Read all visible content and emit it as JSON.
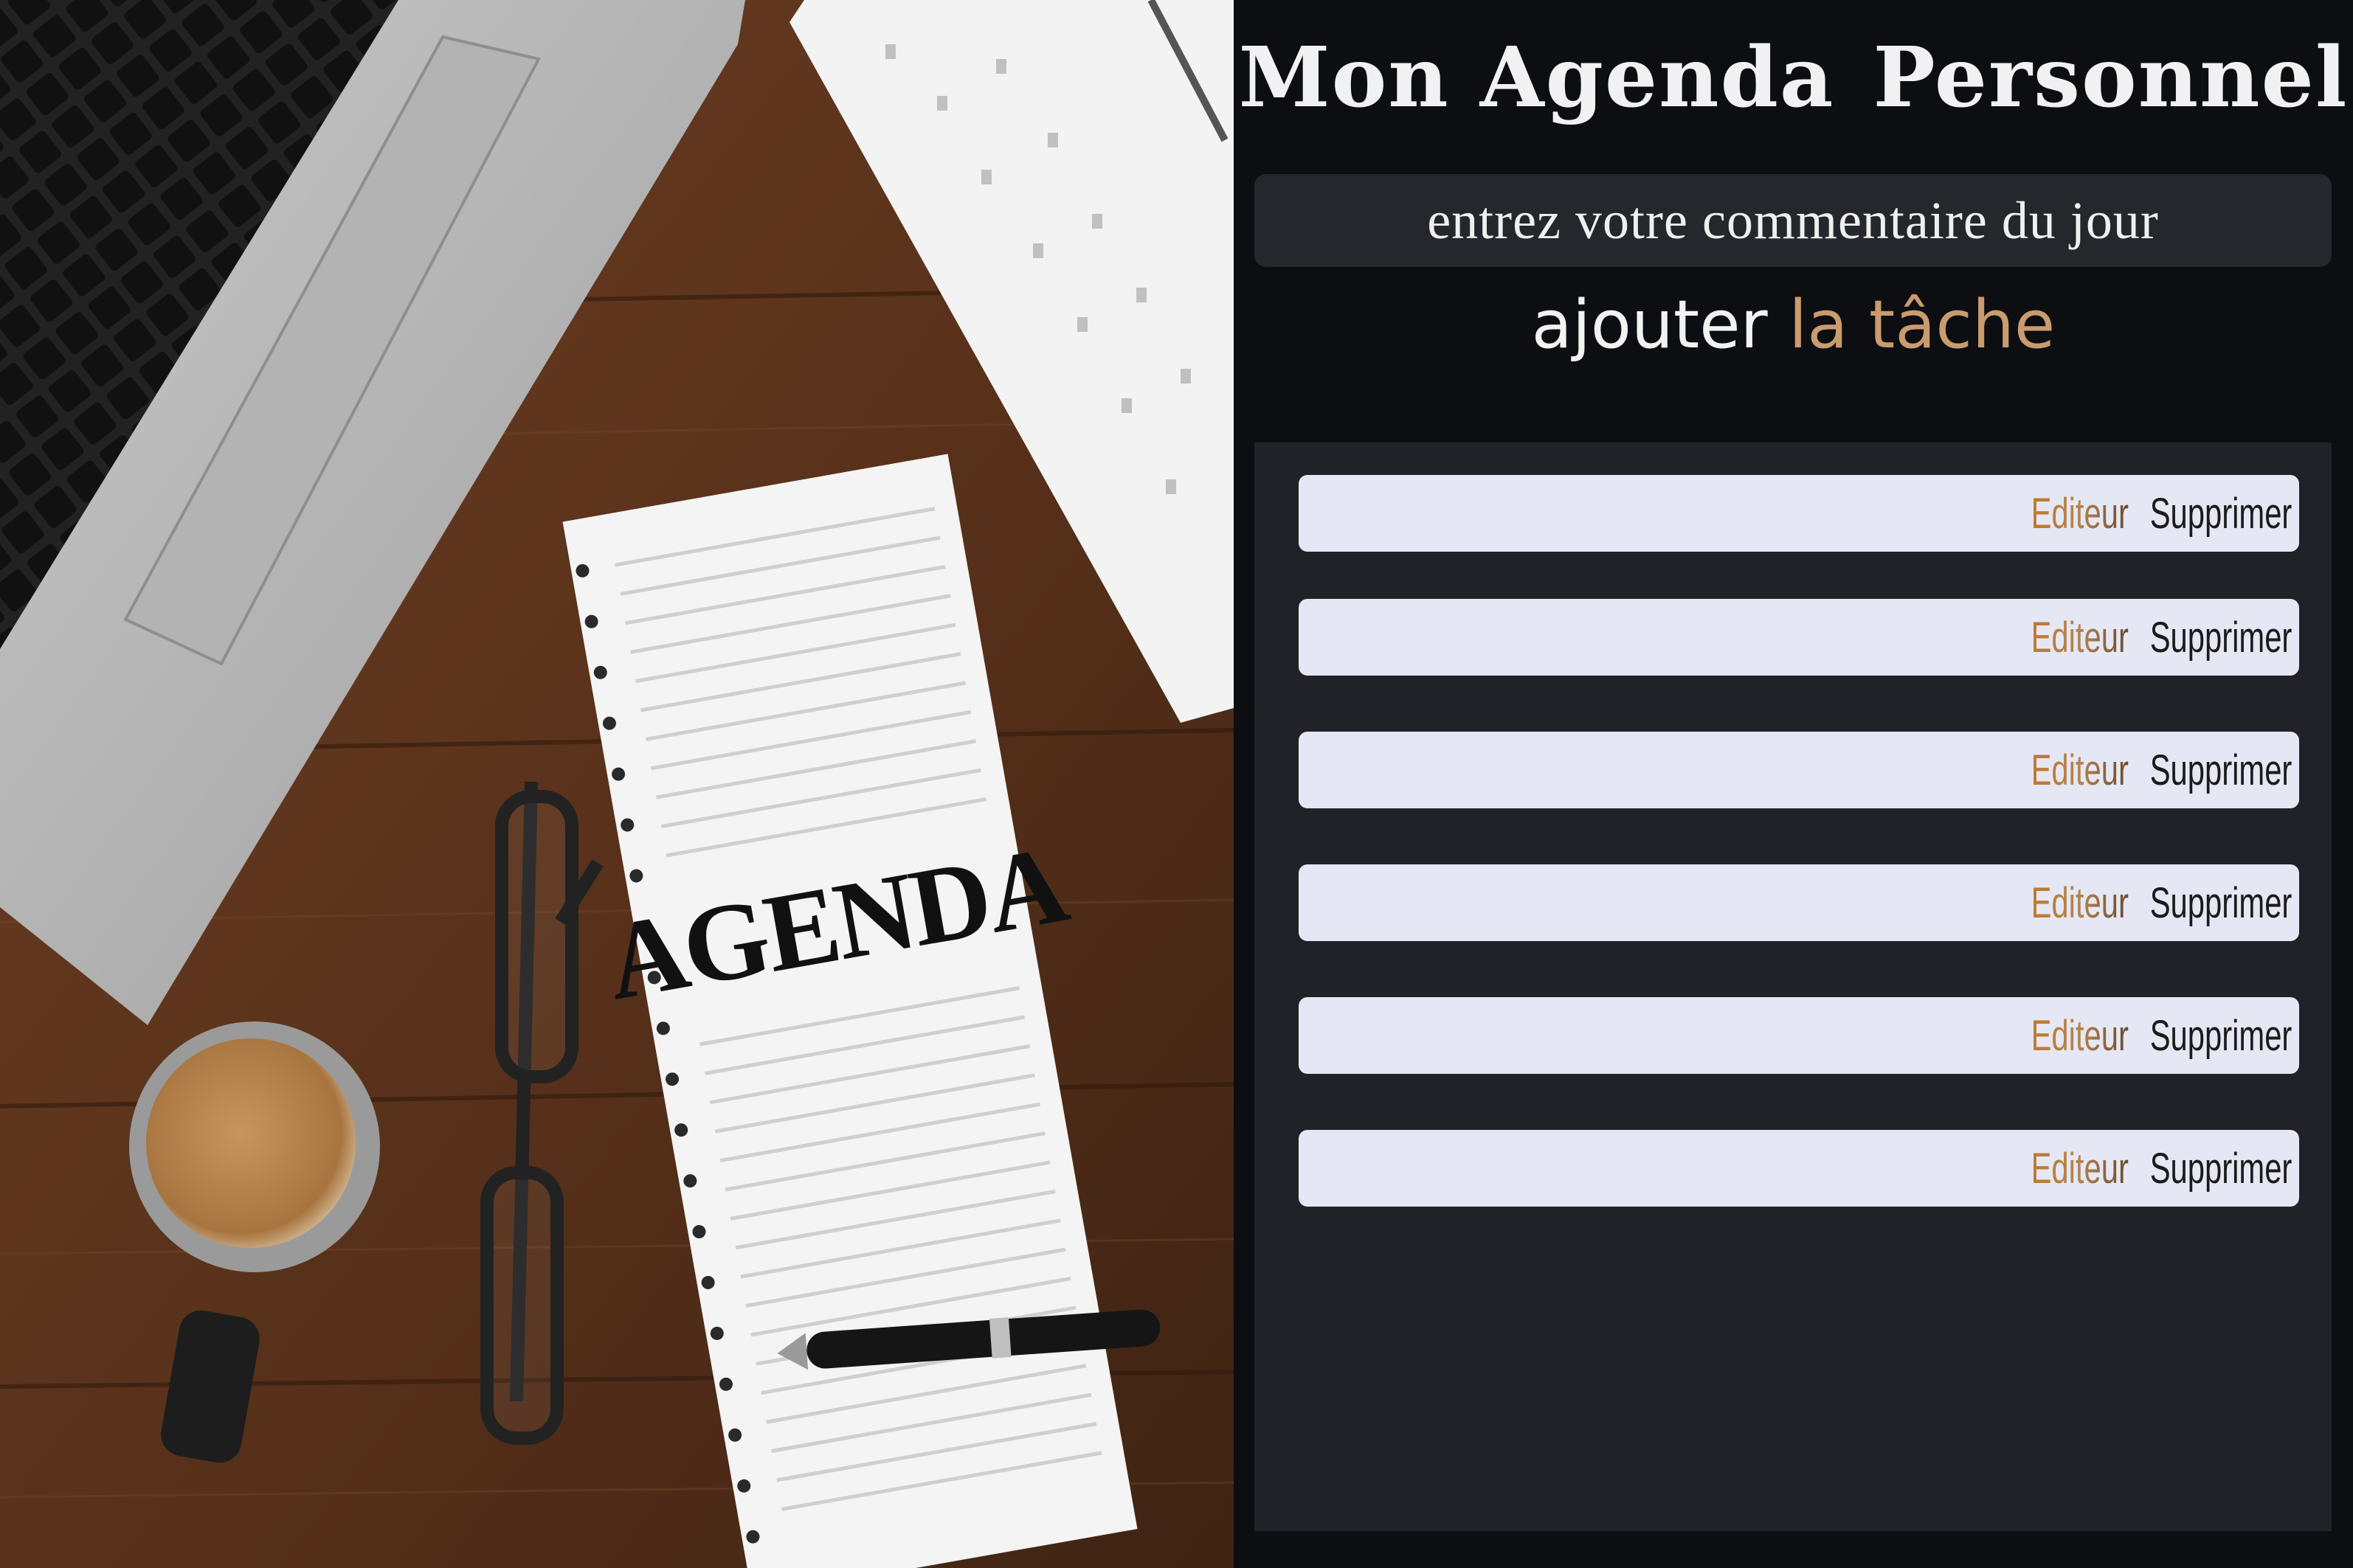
{
  "header": {
    "title_part1": "Mon Agenda",
    "title_part2": "Personnel"
  },
  "form": {
    "input_placeholder": "entrez votre commentaire du jour",
    "input_value": "",
    "add_label_main": "ajouter",
    "add_label_accent": "la tâche",
    "accent_color": "#c99b6d"
  },
  "tasks": [
    {
      "text": "",
      "edit_label": "Editeur",
      "delete_label": "Supprimer"
    },
    {
      "text": "",
      "edit_label": "Editeur",
      "delete_label": "Supprimer"
    },
    {
      "text": "",
      "edit_label": "Editeur",
      "delete_label": "Supprimer"
    },
    {
      "text": "",
      "edit_label": "Editeur",
      "delete_label": "Supprimer"
    },
    {
      "text": "",
      "edit_label": "Editeur",
      "delete_label": "Supprimer"
    },
    {
      "text": "",
      "edit_label": "Editeur",
      "delete_label": "Supprimer"
    }
  ],
  "photo": {
    "notebook_text": "AGENDA"
  }
}
